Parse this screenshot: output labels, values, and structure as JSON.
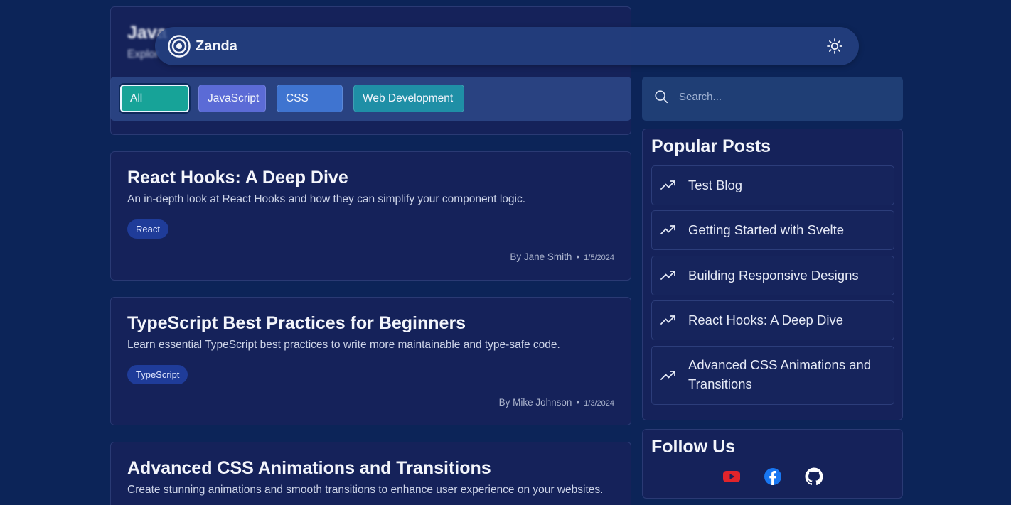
{
  "header": {
    "brand": "Zanda",
    "icons": {
      "logo": "target-logo-icon",
      "theme": "sun-icon"
    }
  },
  "categories": [
    {
      "label": "All",
      "active": true,
      "color": "#17a398"
    },
    {
      "label": "JavaScript",
      "color": "#5b6bd6"
    },
    {
      "label": "CSS",
      "color": "#3f74d0"
    },
    {
      "label": "Web Development",
      "color": "#1f8fa6"
    }
  ],
  "posts": [
    {
      "title": "Java",
      "description": "Explor",
      "tag": ""
    },
    {
      "title": "React Hooks: A Deep Dive",
      "description": "An in-depth look at React Hooks and how they can simplify your component logic.",
      "tag": "React",
      "author": "By Jane Smith",
      "date": "1/5/2024"
    },
    {
      "title": "TypeScript Best Practices for Beginners",
      "description": "Learn essential TypeScript best practices to write more maintainable and type-safe code.",
      "tag": "TypeScript",
      "author": "By Mike Johnson",
      "date": "1/3/2024"
    },
    {
      "title": "Advanced CSS Animations and Transitions",
      "description": "Create stunning animations and smooth transitions to enhance user experience on your websites."
    }
  ],
  "sidebar": {
    "search": {
      "placeholder": "Search...",
      "value": ""
    },
    "popular": {
      "title": "Popular Posts",
      "items": [
        {
          "label": "Test Blog"
        },
        {
          "label": "Getting Started with Svelte"
        },
        {
          "label": "Building Responsive Designs"
        },
        {
          "label": "React Hooks: A Deep Dive"
        },
        {
          "label": "Advanced CSS Animations and Transitions"
        }
      ]
    },
    "follow": {
      "title": "Follow Us",
      "icons": [
        "youtube-icon",
        "facebook-icon",
        "github-icon"
      ]
    }
  },
  "colors": {
    "background": "#0c2458",
    "card": "#15225a",
    "tag": "#1f3c99",
    "youtube": "#e0242b",
    "facebook": "#1877f2"
  }
}
